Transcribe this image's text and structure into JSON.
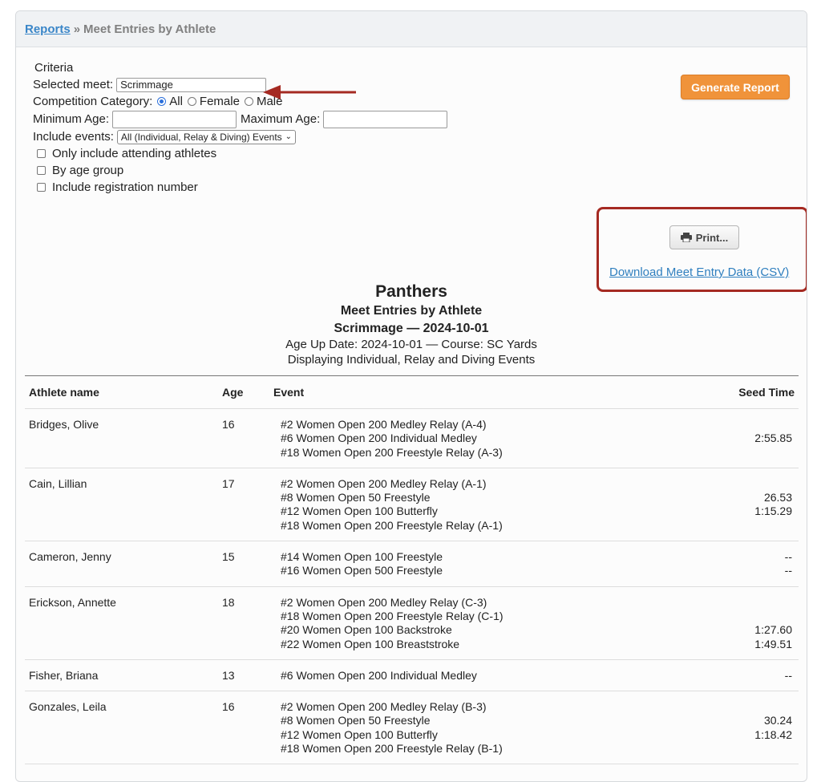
{
  "breadcrumb": {
    "parent": "Reports",
    "separator": "»",
    "current": "Meet Entries by Athlete"
  },
  "criteria": {
    "title": "Criteria",
    "selected_meet_label": "Selected meet:",
    "selected_meet_value": "Scrimmage",
    "competition_category_label": "Competition Category:",
    "category_options": [
      "All",
      "Female",
      "Male"
    ],
    "category_selected": "All",
    "min_age_label": "Minimum Age:",
    "min_age_value": "",
    "max_age_label": "Maximum Age:",
    "max_age_value": "",
    "include_events_label": "Include events:",
    "include_events_value": "All (Individual, Relay & Diving) Events",
    "checkboxes": [
      {
        "label": "Only include attending athletes",
        "checked": false
      },
      {
        "label": "By age group",
        "checked": false
      },
      {
        "label": "Include registration number",
        "checked": false
      }
    ]
  },
  "actions": {
    "generate_label": "Generate Report",
    "print_label": "Print...",
    "csv_label": "Download Meet Entry Data (CSV)"
  },
  "colors": {
    "generate": "#f0933a",
    "highlight": "#a52a22",
    "link": "#2f7fbf"
  },
  "report": {
    "team": "Panthers",
    "title": "Meet Entries by Athlete",
    "meet": "Scrimmage — 2024-10-01",
    "age_line": "Age Up Date: 2024-10-01 — Course: SC Yards",
    "display_line": "Displaying Individual, Relay and Diving Events",
    "columns": [
      "Athlete name",
      "Age",
      "Event",
      "Seed Time"
    ],
    "rows": [
      {
        "name": "Bridges, Olive",
        "age": "16",
        "events": [
          "#2 Women Open 200 Medley Relay (A-4)",
          "#6 Women Open 200 Individual Medley",
          "#18 Women Open 200 Freestyle Relay (A-3)"
        ],
        "seeds": [
          "",
          "2:55.85",
          ""
        ]
      },
      {
        "name": "Cain, Lillian",
        "age": "17",
        "events": [
          "#2 Women Open 200 Medley Relay (A-1)",
          "#8 Women Open 50 Freestyle",
          "#12 Women Open 100 Butterfly",
          "#18 Women Open 200 Freestyle Relay (A-1)"
        ],
        "seeds": [
          "",
          "26.53",
          "1:15.29",
          ""
        ]
      },
      {
        "name": "Cameron, Jenny",
        "age": "15",
        "events": [
          "#14 Women Open 100 Freestyle",
          "#16 Women Open 500 Freestyle"
        ],
        "seeds": [
          "--",
          "--"
        ]
      },
      {
        "name": "Erickson, Annette",
        "age": "18",
        "events": [
          "#2 Women Open 200 Medley Relay (C-3)",
          "#18 Women Open 200 Freestyle Relay (C-1)",
          "#20 Women Open 100 Backstroke",
          "#22 Women Open 100 Breaststroke"
        ],
        "seeds": [
          "",
          "",
          "1:27.60",
          "1:49.51"
        ]
      },
      {
        "name": "Fisher, Briana",
        "age": "13",
        "events": [
          "#6 Women Open 200 Individual Medley"
        ],
        "seeds": [
          "--"
        ]
      },
      {
        "name": "Gonzales, Leila",
        "age": "16",
        "events": [
          "#2 Women Open 200 Medley Relay (B-3)",
          "#8 Women Open 50 Freestyle",
          "#12 Women Open 100 Butterfly",
          "#18 Women Open 200 Freestyle Relay (B-1)"
        ],
        "seeds": [
          "",
          "30.24",
          "1:18.42",
          ""
        ]
      }
    ]
  }
}
